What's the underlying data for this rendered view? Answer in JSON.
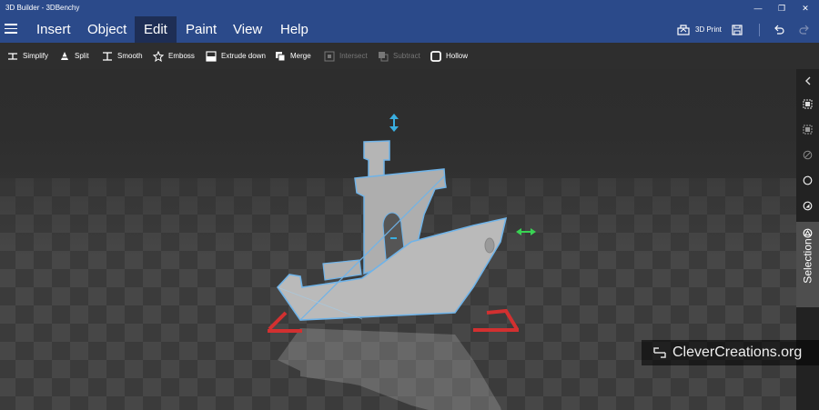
{
  "window": {
    "title": "3D Builder - 3DBenchy"
  },
  "menu": {
    "items": [
      "Insert",
      "Object",
      "Edit",
      "Paint",
      "View",
      "Help"
    ],
    "active": "Edit"
  },
  "header_tools": {
    "print_label": "3D Print"
  },
  "toolbar": {
    "simplify": "Simplify",
    "split": "Split",
    "smooth": "Smooth",
    "emboss": "Emboss",
    "extrude_down": "Extrude down",
    "merge": "Merge",
    "intersect": "Intersect",
    "subtract": "Subtract",
    "hollow": "Hollow"
  },
  "right_panel": {
    "selection_label": "Selection"
  },
  "watermark": {
    "text": "CleverCreations.org"
  },
  "colors": {
    "title_bg": "#2b4a8a",
    "active_menu_bg": "#1e2e55",
    "selection_outline": "#6fb3e8",
    "axis_green": "#39d353",
    "axis_blue": "#3aaee0",
    "base_red": "#d23030"
  }
}
